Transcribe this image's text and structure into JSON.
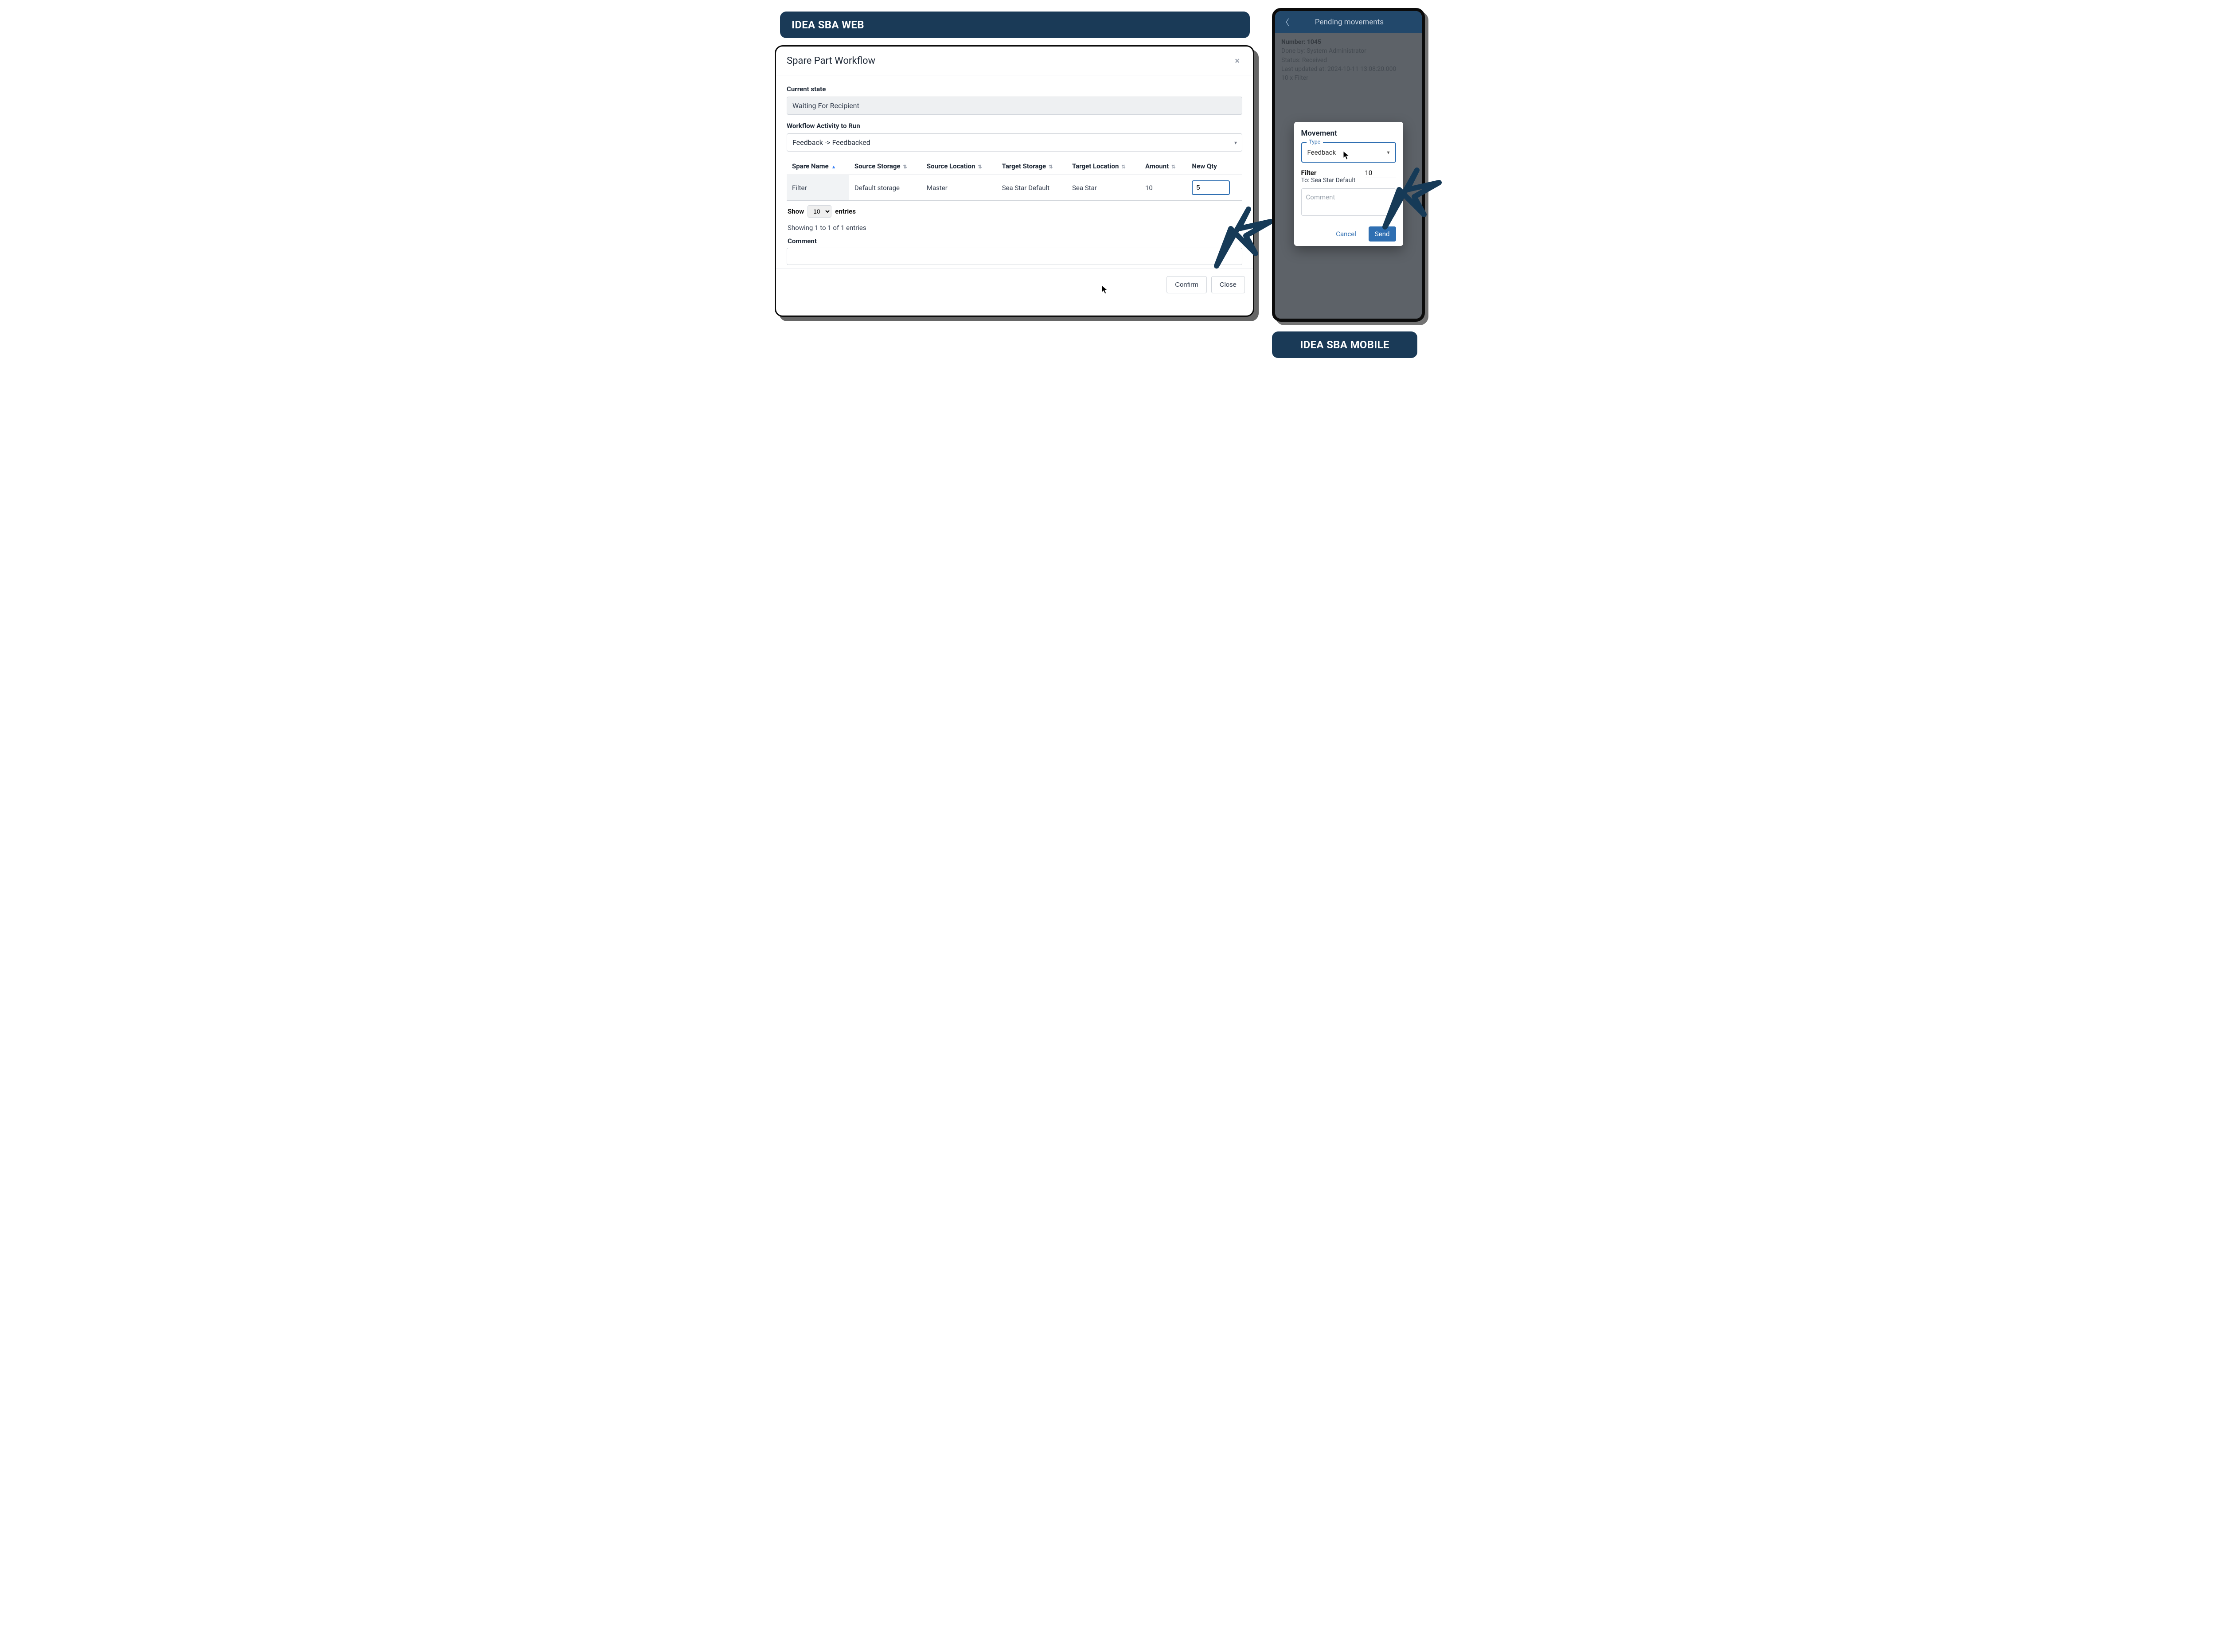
{
  "labels": {
    "web_title": "IDEA SBA WEB",
    "mobile_title": "IDEA SBA MOBILE"
  },
  "web": {
    "modal_title": "Spare Part Workflow",
    "current_state_label": "Current state",
    "current_state_value": "Waiting For Recipient",
    "workflow_label": "Workflow Activity to Run",
    "workflow_value": "Feedback -> Feedbacked",
    "columns": {
      "spare_name": "Spare Name",
      "source_storage": "Source Storage",
      "source_location": "Source Location",
      "target_storage": "Target Storage",
      "target_location": "Target Location",
      "amount": "Amount",
      "new_qty": "New Qty"
    },
    "rows": [
      {
        "spare_name": "Filter",
        "source_storage": "Default storage",
        "source_location": "Master",
        "target_storage": "Sea Star Default",
        "target_location": "Sea Star",
        "amount": "10",
        "new_qty": "5"
      }
    ],
    "show_label": "Show",
    "show_value": "10",
    "entries_label": "entries",
    "showing_text": "Showing 1 to 1 of 1 entries",
    "comment_label": "Comment",
    "comment_value": "",
    "confirm_label": "Confirm",
    "close_label": "Close"
  },
  "mobile": {
    "header_title": "Pending movements",
    "meta": {
      "number_label": "Number:",
      "number_value": "1045",
      "done_by_label": "Done by:",
      "done_by_value": "System Administrator",
      "status_label": "Status:",
      "status_value": "Received",
      "updated_label": "Last updated at:",
      "updated_value": "2024-10-11 13:08:20.000",
      "line_item": "10 x Filter"
    },
    "dialog": {
      "title": "Movement",
      "type_label": "Type",
      "type_value": "Feedback",
      "item_name": "Filter",
      "item_to": "To: Sea Star Default",
      "qty_value": "10",
      "comment_placeholder": "Comment",
      "cancel_label": "Cancel",
      "send_label": "Send"
    }
  }
}
